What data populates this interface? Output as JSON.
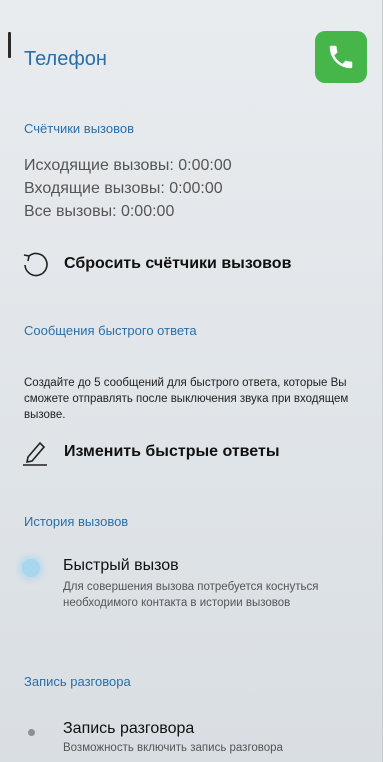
{
  "header": {
    "title": "Телефон",
    "app_icon": "phone-icon",
    "accent": "#2a6fa8",
    "icon_color": "#47b64a"
  },
  "call_counters": {
    "heading": "Счётчики вызовов",
    "outgoing": "Исходящие вызовы: 0:00:00",
    "incoming": "Входящие вызовы: 0:00:00",
    "all": "Все вызовы: 0:00:00",
    "reset_label": "Сбросить счётчики вызовов"
  },
  "quick_replies": {
    "heading": "Сообщения быстрого ответа",
    "description": "Создайте до 5 сообщений для быстрого ответа, которые Вы сможете отправлять после выключения звука при входящем вызове.",
    "edit_label": "Изменить быстрые ответы"
  },
  "call_history": {
    "heading": "История вызовов",
    "quick_call_title": "Быстрый вызов",
    "quick_call_desc": "Для совершения вызова потребуется коснуться необходимого контакта в истории вызовов"
  },
  "recording": {
    "heading": "Запись разговора",
    "title": "Запись разговора",
    "desc": "Возможность включить запись разговора"
  }
}
